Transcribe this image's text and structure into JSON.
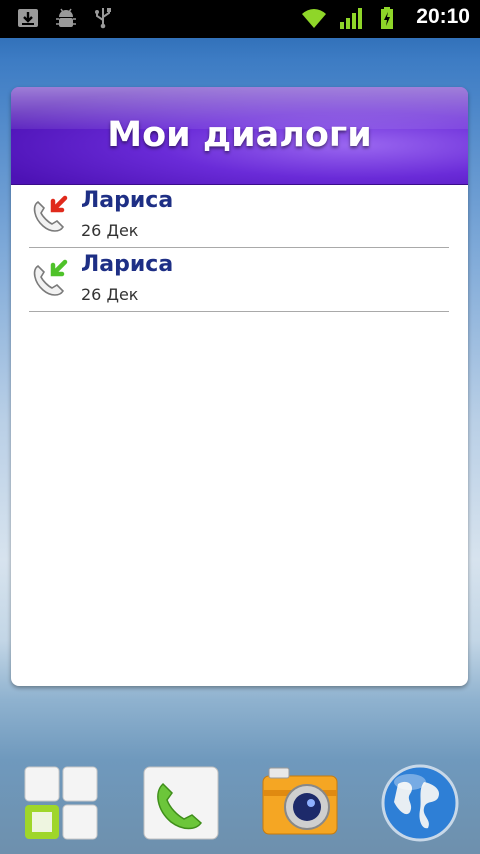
{
  "status_bar": {
    "time": "20:10",
    "icons": [
      "download-icon",
      "android-debug-icon",
      "usb-icon",
      "wifi-icon",
      "signal-icon",
      "battery-charging-icon"
    ]
  },
  "widget": {
    "title": "Мои диалоги",
    "conversations": [
      {
        "name": "Лариса",
        "date": "26 Дек",
        "direction": "outgoing",
        "arrow_color": "#e02a1c"
      },
      {
        "name": "Лариса",
        "date": "26 Дек",
        "direction": "incoming",
        "arrow_color": "#4fc22a"
      }
    ]
  },
  "dock": {
    "apps": [
      "app-drawer-icon",
      "phone-icon",
      "camera-icon",
      "browser-globe-icon"
    ]
  },
  "colors": {
    "header_purple": "#5b1cc4",
    "contact_name": "#1e2f85",
    "status_green": "#8fd629"
  }
}
